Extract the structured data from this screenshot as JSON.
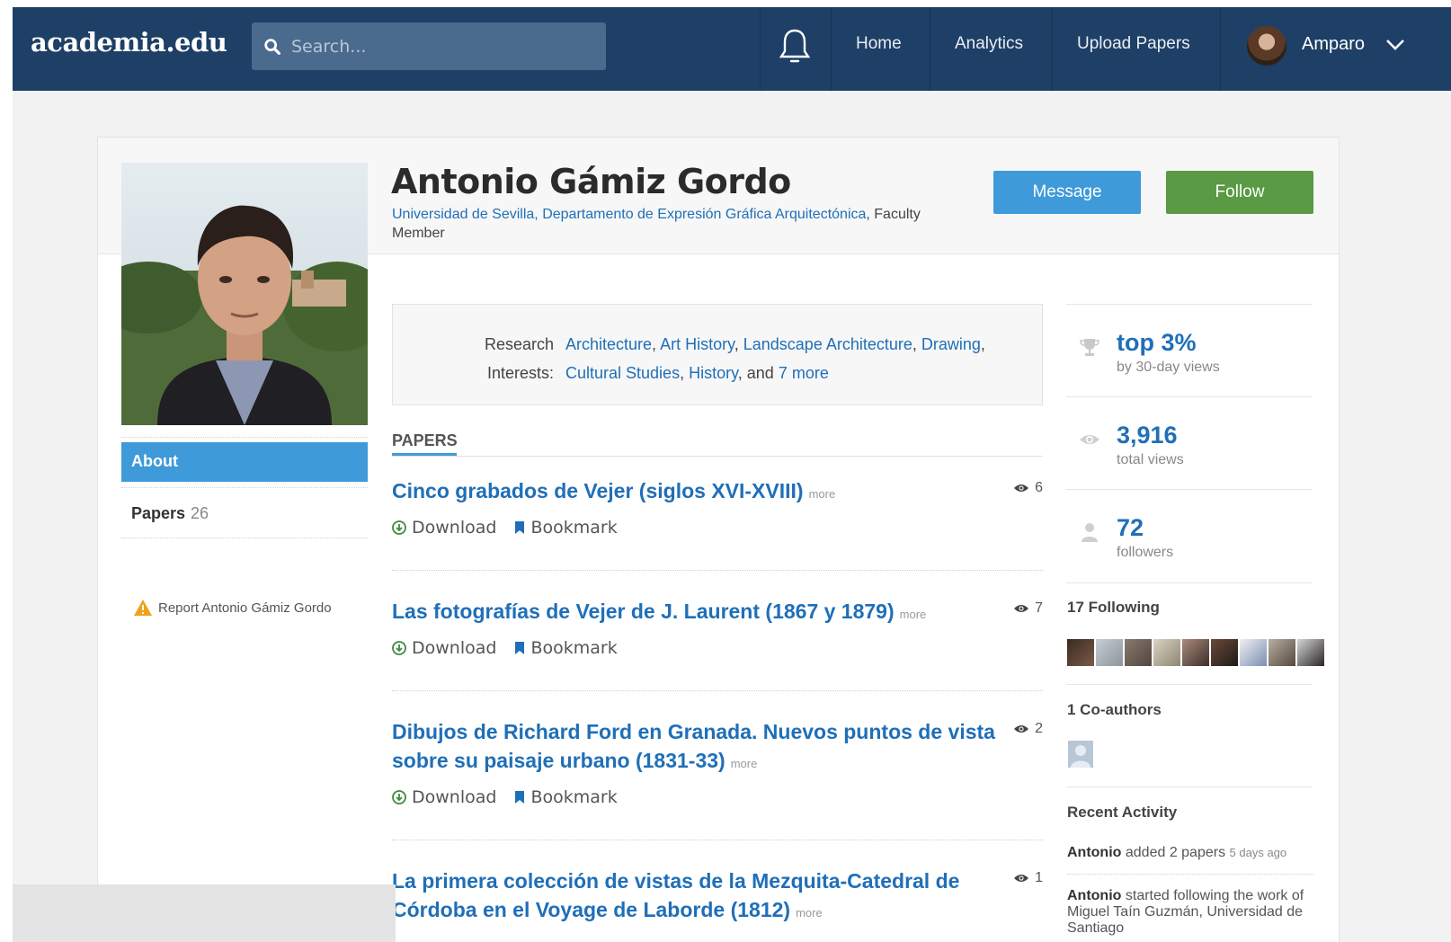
{
  "nav": {
    "logo": "academia.edu",
    "search_placeholder": "Search...",
    "links": [
      "Home",
      "Analytics",
      "Upload Papers"
    ],
    "user": "Amparo"
  },
  "profile": {
    "name": "Antonio Gámiz Gordo",
    "affiliation_link": "Universidad de Sevilla, Departamento de Expresión Gráfica Arquitectónica",
    "affiliation_role": ", Faculty Member",
    "message_label": "Message",
    "follow_label": "Follow"
  },
  "sidebar": {
    "about_label": "About",
    "papers_label": "Papers",
    "papers_count": "26",
    "report_label": "Report Antonio Gámiz Gordo"
  },
  "interests": {
    "label_line1": "Research",
    "label_line2": "Interests:",
    "items": [
      "Architecture",
      "Art History",
      "Landscape Architecture",
      "Drawing",
      "Cultural Studies",
      "History"
    ],
    "and_text": "and",
    "more_text": "7 more"
  },
  "papers": {
    "heading": "PAPERS",
    "more_label": "more",
    "download_label": "Download",
    "bookmark_label": "Bookmark",
    "items": [
      {
        "title": "Cinco grabados de Vejer (siglos XVI-XVIII)",
        "views": "6"
      },
      {
        "title": "Las fotografías de Vejer de J. Laurent (1867 y 1879)",
        "views": "7"
      },
      {
        "title": "Dibujos de Richard Ford en Granada. Nuevos puntos de vista sobre su paisaje urbano (1831-33)",
        "views": "2"
      },
      {
        "title": "La primera colección de vistas de la Mezquita-Catedral de Córdoba en el Voyage de Laborde (1812)",
        "views": "1"
      }
    ]
  },
  "stats": {
    "rank_value": "top 3%",
    "rank_sub": "by 30-day views",
    "views_value": "3,916",
    "views_sub": "total views",
    "followers_value": "72",
    "followers_sub": "followers",
    "following_heading": "17 Following",
    "coauthors_heading": "1 Co-authors",
    "activity_heading": "Recent Activity"
  },
  "activity": [
    {
      "who": "Antonio",
      "text": "added 2 papers",
      "when": "5 days ago"
    },
    {
      "who": "Antonio",
      "text": "started following the work of Miguel Taín Guzmán, Universidad de Santiago",
      "when": ""
    }
  ],
  "colors": {
    "navbar": "#1e3f66",
    "link_blue": "#1f6fb8",
    "message_button": "#3e9ad8",
    "follow_button": "#5a9a44"
  }
}
